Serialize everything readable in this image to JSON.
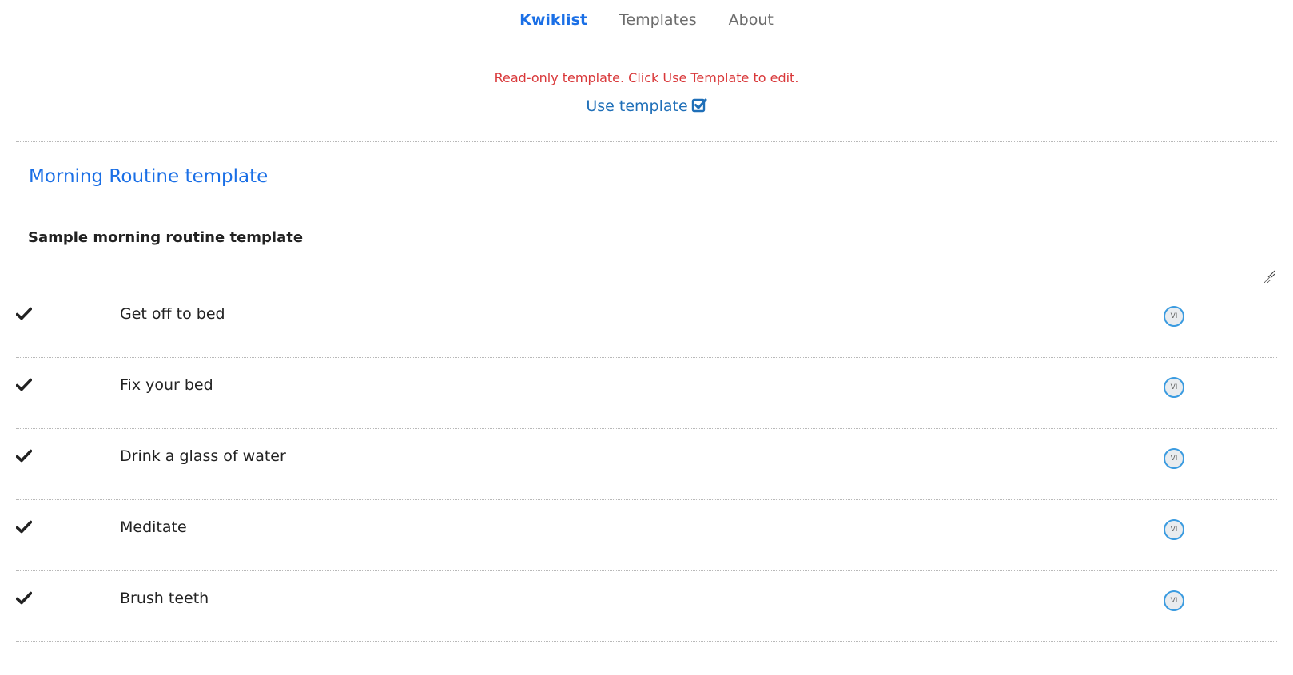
{
  "nav": {
    "brand": "Kwiklist",
    "templates": "Templates",
    "about": "About"
  },
  "notice": "Read-only template. Click Use Template to edit.",
  "use_template_label": "Use template",
  "list": {
    "title": "Morning Routine template",
    "description": "Sample morning routine template"
  },
  "items": [
    {
      "label": "Get off to bed",
      "avatar": "VI",
      "checked": true
    },
    {
      "label": "Fix your bed",
      "avatar": "VI",
      "checked": true
    },
    {
      "label": "Drink a glass of water",
      "avatar": "VI",
      "checked": true
    },
    {
      "label": "Meditate",
      "avatar": "VI",
      "checked": true
    },
    {
      "label": "Brush teeth",
      "avatar": "VI",
      "checked": true
    }
  ],
  "colors": {
    "brand": "#1a6fe6",
    "notice": "#d9383a",
    "link": "#1f6fb8",
    "avatar_ring": "#3a9be0"
  },
  "icons": {
    "use_template": "check-square-icon",
    "item_check": "check-icon",
    "resize": "resize-grip-icon"
  }
}
